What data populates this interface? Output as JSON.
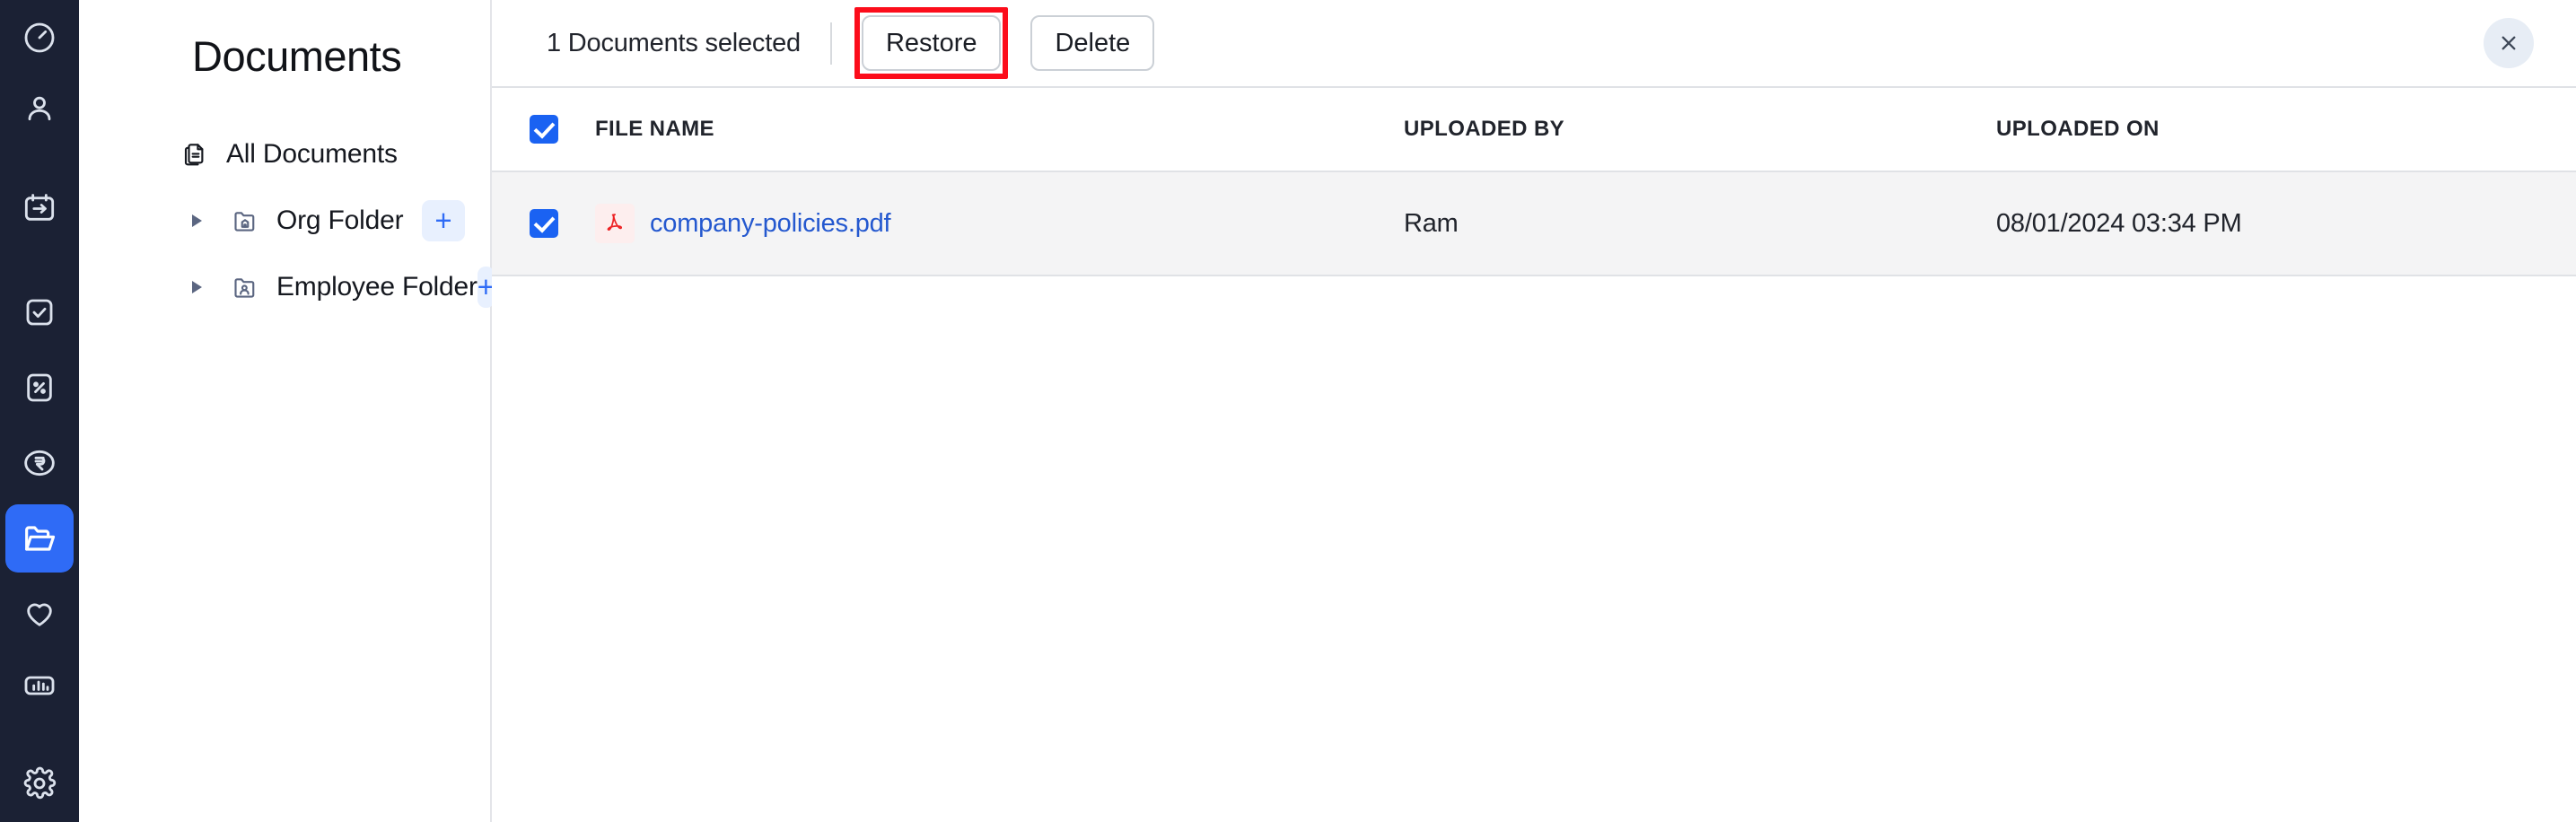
{
  "rail": {
    "items": [
      {
        "name": "dashboard-icon",
        "label": "Dashboard",
        "active": false
      },
      {
        "name": "people-icon",
        "label": "People",
        "active": false
      },
      {
        "name": "calendar-arrow-icon",
        "label": "Leave",
        "active": false
      },
      {
        "name": "task-check-icon",
        "label": "Tasks",
        "active": false
      },
      {
        "name": "percent-doc-icon",
        "label": "Payroll Tax",
        "active": false
      },
      {
        "name": "rupee-circle-icon",
        "label": "Payroll",
        "active": false
      },
      {
        "name": "folder-open-icon",
        "label": "Documents",
        "active": true
      },
      {
        "name": "heart-icon",
        "label": "Benefits",
        "active": false
      },
      {
        "name": "bar-chart-icon",
        "label": "Reports",
        "active": false
      },
      {
        "name": "gear-icon",
        "label": "Settings",
        "active": false
      }
    ],
    "active_color": "#2f6bf6",
    "background_color": "#1b2134"
  },
  "sidebar": {
    "title": "Documents",
    "items": [
      {
        "label": "All Documents",
        "icon": "documents-icon",
        "expandable": false,
        "has_add": false
      },
      {
        "label": "Org Folder",
        "icon": "org-folder-icon",
        "expandable": true,
        "has_add": true
      },
      {
        "label": "Employee Folder",
        "icon": "employee-folder-icon",
        "expandable": true,
        "has_add": true
      }
    ],
    "add_button_label": "+"
  },
  "toolbar": {
    "selection_text": "1 Documents selected",
    "restore_label": "Restore",
    "delete_label": "Delete",
    "close_label": "×",
    "highlight_color": "#fc0d1b",
    "highlighted_button": "Restore"
  },
  "table": {
    "columns": [
      "FILE NAME",
      "UPLOADED BY",
      "UPLOADED ON"
    ],
    "header_checkbox_checked": true,
    "rows": [
      {
        "checked": true,
        "file_name": "company-policies.pdf",
        "file_type_icon": "pdf-icon",
        "uploaded_by": "Ram",
        "uploaded_on": "08/01/2024 03:34 PM"
      }
    ],
    "link_color": "#2458cf",
    "row_background": "#f4f4f5"
  }
}
